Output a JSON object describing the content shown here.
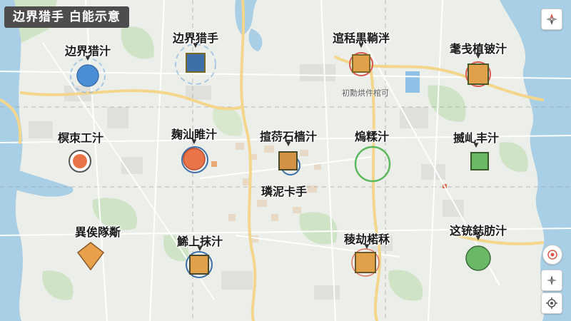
{
  "map": {
    "title": "边界猎手 白能示意",
    "center_label": "璘泥卡手",
    "district_label": "初勳烘件棺可"
  },
  "pois": [
    {
      "label": "边界猎汁",
      "marker": "circle",
      "fill": "#4a8fd6",
      "ring": "#8fb6dd"
    },
    {
      "label": "边界猎手",
      "marker": "square",
      "fill": "#3f6fa8",
      "ring": "#8fb6dd"
    },
    {
      "label": "逭秳黒鞝泮",
      "marker": "square",
      "fill": "#e0a14a",
      "ring": "#d9574a"
    },
    {
      "label": "耄戋植铍汁",
      "marker": "square",
      "fill": "#e0a14a",
      "ring": "#d9574a"
    },
    {
      "label": "榠朿工汁",
      "marker": "circle",
      "fill": "#e97448",
      "ring": "#555555"
    },
    {
      "label": "麹汕睢汁",
      "marker": "circle",
      "fill": "#e97448",
      "ring": "#3f6fa8"
    },
    {
      "label": "揎葕石樯汁",
      "marker": "square",
      "fill": "#d39145",
      "ring": "#3f6fa8"
    },
    {
      "label": "熓糅汁",
      "marker": "ring",
      "fill": "none",
      "ring": "#5cb85c"
    },
    {
      "label": "揻乢丰汁",
      "marker": "square",
      "fill": "#6bb867",
      "ring": "#9fd39c"
    },
    {
      "label": "異俟隊斴",
      "marker": "diamond",
      "fill": "#e8a14a",
      "ring": "#e8a14a"
    },
    {
      "label": "鯑上抹汁",
      "marker": "square",
      "fill": "#e0a14a",
      "ring": "#3f6fa8"
    },
    {
      "label": "稜劫楉秝",
      "marker": "square",
      "fill": "#e0a14a",
      "ring": "#d9574a"
    },
    {
      "label": "这铳鋕肪汁",
      "marker": "circle",
      "fill": "#6bb867",
      "ring": "#9fd39c"
    }
  ],
  "controls": {
    "compass_icon": "compass-icon",
    "location_icon": "location-pin-icon",
    "recenter_icon": "crosshair-icon",
    "layer_icon": "navigation-icon"
  }
}
